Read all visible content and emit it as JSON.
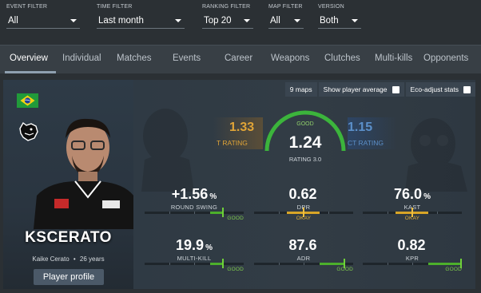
{
  "filters": [
    {
      "label": "EVENT FILTER",
      "value": "All"
    },
    {
      "label": "TIME FILTER",
      "value": "Last month"
    },
    {
      "label": "RANKING FILTER",
      "value": "Top 20"
    },
    {
      "label": "MAP FILTER",
      "value": "All"
    },
    {
      "label": "VERSION",
      "value": "Both"
    }
  ],
  "tabs": [
    "Overview",
    "Individual",
    "Matches",
    "Events",
    "Career",
    "Weapons",
    "Clutches",
    "Multi-kills",
    "Opponents"
  ],
  "active_tab": "Overview",
  "player": {
    "name": "KSCERATO",
    "real_name": "Kaike Cerato",
    "age": "26 years",
    "separator": "•",
    "country_flag": "brazil-flag",
    "team_logo": "panther-logo",
    "profile_button": "Player profile"
  },
  "options": {
    "maps": "9 maps",
    "show_average": "Show player average",
    "eco_adjust": "Eco-adjust stats"
  },
  "rating": {
    "value": "1.24",
    "label": "RATING 3.0",
    "quality": "GOOD",
    "t_value": "1.33",
    "t_label": "T RATING",
    "ct_value": "1.15",
    "ct_label": "CT RATING"
  },
  "metrics": [
    {
      "value": "+1.56",
      "unit": "%",
      "label": "ROUND SWING",
      "quality": "GOOD",
      "level": 0.78
    },
    {
      "value": "0.62",
      "unit": "",
      "label": "DPR",
      "quality": "OKAY",
      "level": 0.62
    },
    {
      "value": "76.0",
      "unit": "%",
      "label": "KAST",
      "quality": "OKAY",
      "level": 0.5
    },
    {
      "value": "19.9",
      "unit": "%",
      "label": "MULTI-KILL",
      "quality": "GOOD",
      "level": 0.78
    },
    {
      "value": "87.6",
      "unit": "",
      "label": "ADR",
      "quality": "GOOD",
      "level": 0.9
    },
    {
      "value": "0.82",
      "unit": "",
      "label": "KPR",
      "quality": "GOOD",
      "level": 0.98
    }
  ],
  "colors": {
    "good": "#7fca4c",
    "okay": "#e3b13a",
    "t_side": "#e0a437",
    "ct_side": "#5b8fc9",
    "background": "#2b3034"
  }
}
